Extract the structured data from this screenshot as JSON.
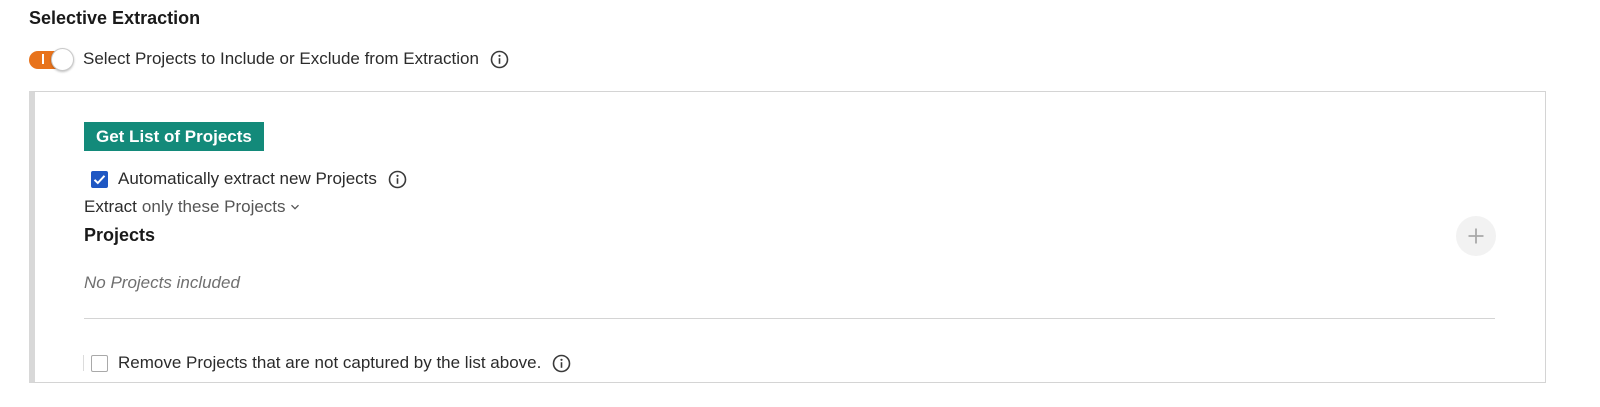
{
  "section": {
    "title": "Selective Extraction"
  },
  "toggle": {
    "label": "Select Projects to Include or Exclude from Extraction",
    "state": "on",
    "on_glyph": "I",
    "color": "#e8731c"
  },
  "panel": {
    "get_list_button": "Get List of Projects",
    "button_color": "#138a7a",
    "auto_extract": {
      "label": "Automatically extract new Projects",
      "checked": true,
      "color": "#1f57c3"
    },
    "extract_mode": {
      "prefix": "Extract",
      "selected": "only these Projects"
    },
    "projects": {
      "heading": "Projects",
      "empty_text": "No Projects included",
      "add_icon": "plus-icon"
    },
    "remove_option": {
      "label": "Remove Projects that are not captured by the list above.",
      "checked": false
    }
  },
  "icons": {
    "info": "info-circle-icon",
    "chevron": "chevron-down-icon",
    "check": "check-icon"
  }
}
